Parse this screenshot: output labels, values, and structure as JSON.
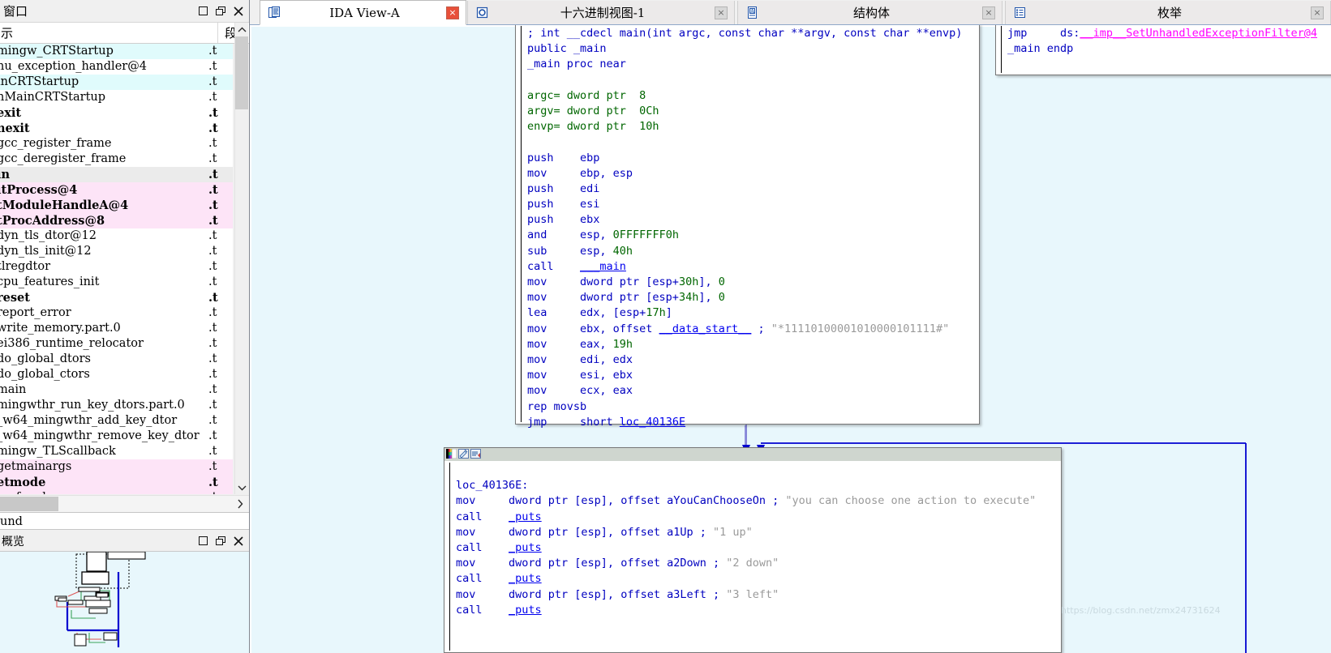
{
  "left_panel": {
    "window_title": "窗口",
    "window_buttons": [
      "maximize",
      "restore",
      "close"
    ],
    "columns": {
      "name": "示",
      "segment": "段"
    },
    "functions": [
      {
        "name": "mingw_CRTStartup",
        "seg": ".t",
        "hl": "cyan",
        "bold": false
      },
      {
        "name": "nu_exception_handler@4",
        "seg": ".t",
        "hl": "none",
        "bold": false
      },
      {
        "name": "inCRTStartup",
        "seg": ".t",
        "hl": "cyan",
        "bold": false
      },
      {
        "name": "nMainCRTStartup",
        "seg": ".t",
        "hl": "none",
        "bold": false
      },
      {
        "name": "exit",
        "seg": ".t",
        "hl": "none",
        "bold": true
      },
      {
        "name": "nexit",
        "seg": ".t",
        "hl": "none",
        "bold": true
      },
      {
        "name": "gcc_register_frame",
        "seg": ".t",
        "hl": "none",
        "bold": false
      },
      {
        "name": "gcc_deregister_frame",
        "seg": ".t",
        "hl": "none",
        "bold": false
      },
      {
        "name": "in",
        "seg": ".t",
        "hl": "gray",
        "bold": true
      },
      {
        "name": "itProcess@4",
        "seg": ".t",
        "hl": "pink",
        "bold": true
      },
      {
        "name": "tModuleHandleA@4",
        "seg": ".t",
        "hl": "pink",
        "bold": true
      },
      {
        "name": "tProcAddress@8",
        "seg": ".t",
        "hl": "pink",
        "bold": true
      },
      {
        "name": "dyn_tls_dtor@12",
        "seg": ".t",
        "hl": "none",
        "bold": false
      },
      {
        "name": "dyn_tls_init@12",
        "seg": ".t",
        "hl": "none",
        "bold": false
      },
      {
        "name": "tlregdtor",
        "seg": ".t",
        "hl": "none",
        "bold": false
      },
      {
        "name": "cpu_features_init",
        "seg": ".t",
        "hl": "none",
        "bold": false
      },
      {
        "name": "reset",
        "seg": ".t",
        "hl": "none",
        "bold": true
      },
      {
        "name": "report_error",
        "seg": ".t",
        "hl": "none",
        "bold": false
      },
      {
        "name": "write_memory.part.0",
        "seg": ".t",
        "hl": "none",
        "bold": false
      },
      {
        "name": "ei386_runtime_relocator",
        "seg": ".t",
        "hl": "none",
        "bold": false
      },
      {
        "name": "do_global_dtors",
        "seg": ".t",
        "hl": "none",
        "bold": false
      },
      {
        "name": "do_global_ctors",
        "seg": ".t",
        "hl": "none",
        "bold": false
      },
      {
        "name": "main",
        "seg": ".t",
        "hl": "none",
        "bold": false
      },
      {
        "name": "mingwthr_run_key_dtors.part.0",
        "seg": ".t",
        "hl": "none",
        "bold": false
      },
      {
        "name": "_w64_mingwthr_add_key_dtor",
        "seg": ".t",
        "hl": "none",
        "bold": false
      },
      {
        "name": "_w64_mingwthr_remove_key_dtor",
        "seg": ".t",
        "hl": "none",
        "bold": false
      },
      {
        "name": "mingw_TLScallback",
        "seg": ".t",
        "hl": "none",
        "bold": false
      },
      {
        "name": "getmainargs",
        "seg": ".t",
        "hl": "pink",
        "bold": false
      },
      {
        "name": "etmode",
        "seg": ".t",
        "hl": "pink",
        "bold": true
      },
      {
        "name": "p__fmode",
        "seg": ".t",
        "hl": "pink",
        "bold": false
      }
    ],
    "status_text": "und",
    "overview": {
      "title": "概览",
      "buttons": [
        "maximize",
        "restore",
        "close"
      ]
    }
  },
  "tabs": [
    {
      "label": "IDA View-A",
      "icon": "ida-view-icon",
      "active": true,
      "close": "×"
    },
    {
      "label": "十六进制视图-1",
      "icon": "hex-view-icon",
      "active": false,
      "close": "×"
    },
    {
      "label": "结构体",
      "icon": "structs-icon",
      "active": false,
      "close": "×"
    },
    {
      "label": "枚举",
      "icon": "enums-icon",
      "active": false,
      "close": "×"
    }
  ],
  "graph": {
    "node_main": {
      "lines": [
        {
          "i": 0,
          "segs": [
            {
              "t": "; int __cdecl main(int argc, const char **argv, const char **envp)",
              "c": "mn"
            }
          ]
        },
        {
          "i": 1,
          "segs": [
            {
              "t": "public _main",
              "c": "mn"
            }
          ]
        },
        {
          "i": 2,
          "segs": [
            {
              "t": "_main proc near",
              "c": "mn"
            }
          ]
        },
        {
          "i": 3,
          "segs": [
            {
              "t": "",
              "c": "mn"
            }
          ]
        },
        {
          "i": 4,
          "segs": [
            {
              "t": "argc= dword ptr  ",
              "c": "var"
            },
            {
              "t": "8",
              "c": "num"
            }
          ]
        },
        {
          "i": 5,
          "segs": [
            {
              "t": "argv= dword ptr  ",
              "c": "var"
            },
            {
              "t": "0Ch",
              "c": "num"
            }
          ]
        },
        {
          "i": 6,
          "segs": [
            {
              "t": "envp= dword ptr  ",
              "c": "var"
            },
            {
              "t": "10h",
              "c": "num"
            }
          ]
        },
        {
          "i": 7,
          "segs": [
            {
              "t": "",
              "c": "mn"
            }
          ]
        },
        {
          "i": 8,
          "segs": [
            {
              "t": "push    ebp",
              "c": "mn"
            }
          ]
        },
        {
          "i": 9,
          "segs": [
            {
              "t": "mov     ebp, esp",
              "c": "mn"
            }
          ]
        },
        {
          "i": 10,
          "segs": [
            {
              "t": "push    edi",
              "c": "mn"
            }
          ]
        },
        {
          "i": 11,
          "segs": [
            {
              "t": "push    esi",
              "c": "mn"
            }
          ]
        },
        {
          "i": 12,
          "segs": [
            {
              "t": "push    ebx",
              "c": "mn"
            }
          ]
        },
        {
          "i": 13,
          "segs": [
            {
              "t": "and     esp, ",
              "c": "mn"
            },
            {
              "t": "0FFFFFFF0h",
              "c": "num"
            }
          ]
        },
        {
          "i": 14,
          "segs": [
            {
              "t": "sub     esp, ",
              "c": "mn"
            },
            {
              "t": "40h",
              "c": "num"
            }
          ]
        },
        {
          "i": 15,
          "segs": [
            {
              "t": "call    ",
              "c": "mn"
            },
            {
              "t": "___main",
              "c": "nam"
            }
          ]
        },
        {
          "i": 16,
          "segs": [
            {
              "t": "mov     dword ptr [esp+",
              "c": "mn"
            },
            {
              "t": "30h",
              "c": "num"
            },
            {
              "t": "], ",
              "c": "mn"
            },
            {
              "t": "0",
              "c": "num"
            }
          ]
        },
        {
          "i": 17,
          "segs": [
            {
              "t": "mov     dword ptr [esp+",
              "c": "mn"
            },
            {
              "t": "34h",
              "c": "num"
            },
            {
              "t": "], ",
              "c": "mn"
            },
            {
              "t": "0",
              "c": "num"
            }
          ]
        },
        {
          "i": 18,
          "segs": [
            {
              "t": "lea     edx, [esp+",
              "c": "mn"
            },
            {
              "t": "17h",
              "c": "num"
            },
            {
              "t": "]",
              "c": "mn"
            }
          ]
        },
        {
          "i": 19,
          "segs": [
            {
              "t": "mov     ebx, offset ",
              "c": "mn"
            },
            {
              "t": "__data_start__",
              "c": "nam"
            },
            {
              "t": " ; ",
              "c": "mn"
            },
            {
              "t": "\"*11110100001010000101111#\"",
              "c": "cmt"
            }
          ]
        },
        {
          "i": 20,
          "segs": [
            {
              "t": "mov     eax, ",
              "c": "mn"
            },
            {
              "t": "19h",
              "c": "num"
            }
          ]
        },
        {
          "i": 21,
          "segs": [
            {
              "t": "mov     edi, edx",
              "c": "mn"
            }
          ]
        },
        {
          "i": 22,
          "segs": [
            {
              "t": "mov     esi, ebx",
              "c": "mn"
            }
          ]
        },
        {
          "i": 23,
          "segs": [
            {
              "t": "mov     ecx, eax",
              "c": "mn"
            }
          ]
        },
        {
          "i": 24,
          "segs": [
            {
              "t": "rep movsb",
              "c": "mn"
            }
          ]
        },
        {
          "i": 25,
          "segs": [
            {
              "t": "jmp     short ",
              "c": "mn"
            },
            {
              "t": "loc_40136E",
              "c": "nam"
            }
          ]
        }
      ]
    },
    "node_right": {
      "lines": [
        {
          "i": 0,
          "segs": [
            {
              "t": "jmp     ds:",
              "c": "mn"
            },
            {
              "t": "__imp__SetUnhandledExceptionFilter@4",
              "c": "imp"
            }
          ]
        },
        {
          "i": 1,
          "segs": [
            {
              "t": "_main endp",
              "c": "mn"
            }
          ]
        }
      ]
    },
    "node_loc": {
      "toolbar_icons": [
        "palette-icon",
        "edit-icon",
        "sync-icon"
      ],
      "lines": [
        {
          "i": 0,
          "segs": [
            {
              "t": "",
              "c": "mn"
            }
          ]
        },
        {
          "i": 1,
          "segs": [
            {
              "t": "loc_40136E:",
              "c": "lbl"
            }
          ]
        },
        {
          "i": 2,
          "segs": [
            {
              "t": "mov     dword ptr [esp], offset ",
              "c": "mn"
            },
            {
              "t": "aYouCanChooseOn",
              "c": "mn"
            },
            {
              "t": " ; ",
              "c": "mn"
            },
            {
              "t": "\"you can choose one action to execute\"",
              "c": "cmt"
            }
          ]
        },
        {
          "i": 3,
          "segs": [
            {
              "t": "call    ",
              "c": "mn"
            },
            {
              "t": "_puts",
              "c": "nam"
            }
          ]
        },
        {
          "i": 4,
          "segs": [
            {
              "t": "mov     dword ptr [esp], offset ",
              "c": "mn"
            },
            {
              "t": "a1Up",
              "c": "mn"
            },
            {
              "t": " ; ",
              "c": "mn"
            },
            {
              "t": "\"1 up\"",
              "c": "cmt"
            }
          ]
        },
        {
          "i": 5,
          "segs": [
            {
              "t": "call    ",
              "c": "mn"
            },
            {
              "t": "_puts",
              "c": "nam"
            }
          ]
        },
        {
          "i": 6,
          "segs": [
            {
              "t": "mov     dword ptr [esp], offset ",
              "c": "mn"
            },
            {
              "t": "a2Down",
              "c": "mn"
            },
            {
              "t": " ; ",
              "c": "mn"
            },
            {
              "t": "\"2 down\"",
              "c": "cmt"
            }
          ]
        },
        {
          "i": 7,
          "segs": [
            {
              "t": "call    ",
              "c": "mn"
            },
            {
              "t": "_puts",
              "c": "nam"
            }
          ]
        },
        {
          "i": 8,
          "segs": [
            {
              "t": "mov     dword ptr [esp], offset ",
              "c": "mn"
            },
            {
              "t": "a3Left",
              "c": "mn"
            },
            {
              "t": " ; ",
              "c": "mn"
            },
            {
              "t": "\"3 left\"",
              "c": "cmt"
            }
          ]
        },
        {
          "i": 9,
          "segs": [
            {
              "t": "call    ",
              "c": "mn"
            },
            {
              "t": "_puts",
              "c": "nam"
            }
          ]
        }
      ]
    }
  },
  "watermark": "https://blog.csdn.net/zmx24731624",
  "colors": {
    "graph_bg": "#e8f7fc",
    "node_bg": "#ffffff",
    "edge_blue": "#0000d0",
    "mnemonic": "#0000c0",
    "number": "#006600",
    "comment": "#9a9a9a",
    "import": "#ff00ff",
    "highlight_cyan": "#e0fbfc",
    "highlight_pink": "#fde4f7",
    "highlight_gray": "#ebebeb",
    "active_tab_close": "#e8503a"
  }
}
